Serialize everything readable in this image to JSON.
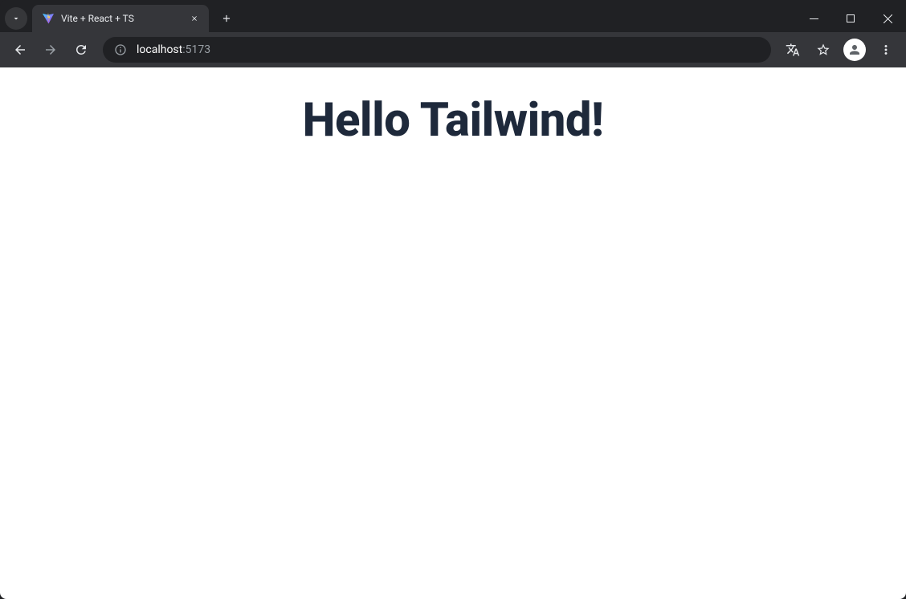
{
  "tab": {
    "title": "Vite + React + TS"
  },
  "address": {
    "host": "localhost",
    "port": ":5173"
  },
  "page": {
    "heading": "Hello Tailwind!"
  }
}
